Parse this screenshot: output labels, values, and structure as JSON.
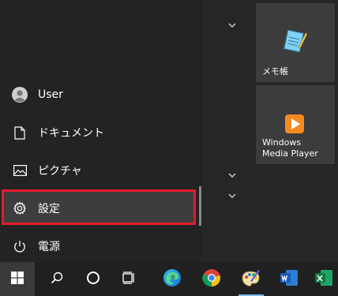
{
  "start_menu": {
    "user": {
      "label": "User"
    },
    "documents": {
      "label": "ドキュメント"
    },
    "pictures": {
      "label": "ピクチャ"
    },
    "settings": {
      "label": "設定"
    },
    "power": {
      "label": "電源"
    }
  },
  "tiles": {
    "notepad": {
      "label": "メモ帳"
    },
    "wmp": {
      "label": "Windows\nMedia Player"
    }
  },
  "taskbar": {
    "items": [
      "start",
      "search",
      "cortana",
      "task-view",
      "edge",
      "chrome",
      "paint",
      "word",
      "excel"
    ]
  },
  "colors": {
    "highlight_border": "#e21c2c",
    "accent": "#76b9ed"
  }
}
